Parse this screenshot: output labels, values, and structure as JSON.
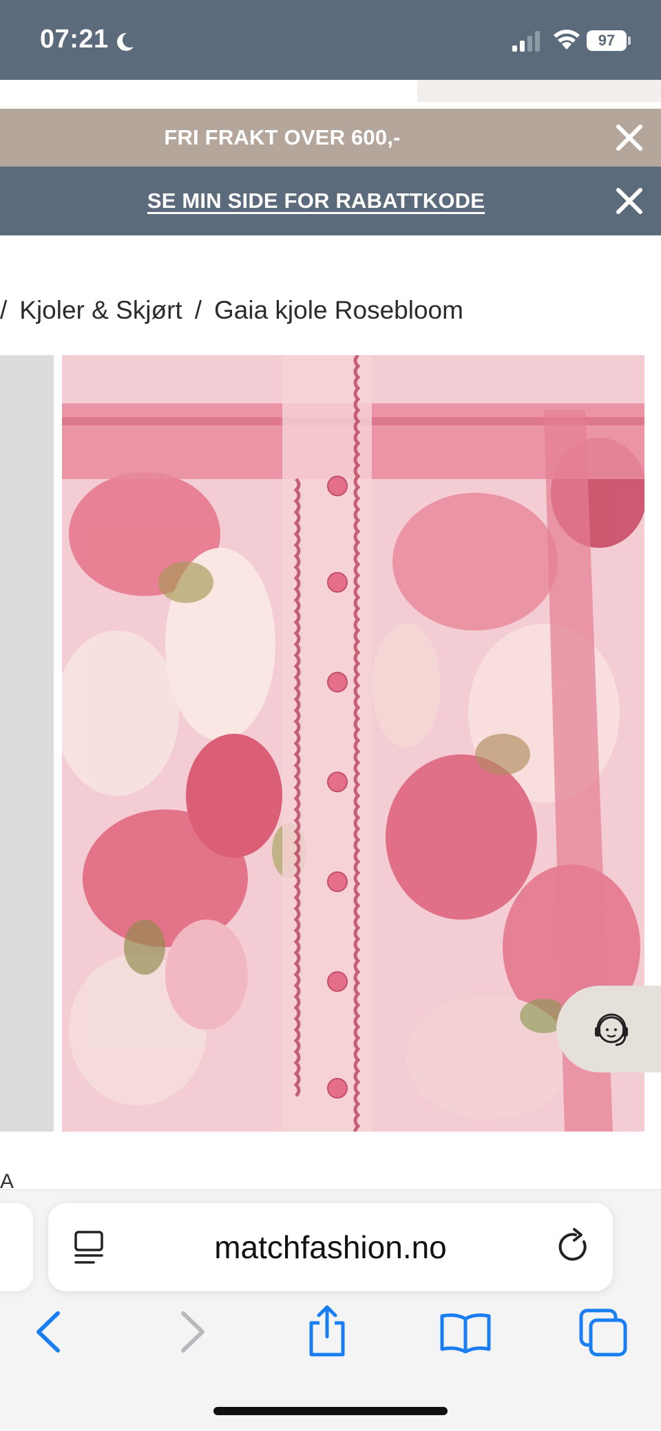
{
  "status_bar": {
    "time": "07:21",
    "battery": "97",
    "icons": [
      "moon-icon",
      "signal-icon",
      "wifi-icon",
      "battery-icon"
    ]
  },
  "banners": {
    "shipping": "FRI FRAKT OVER 600,-",
    "discount": "SE MIN SIDE FOR RABATTKODE"
  },
  "breadcrumb": {
    "separator": "/",
    "items": [
      "Kjoler & Skjørt",
      "Gaia kjole Rosebloom"
    ]
  },
  "product": {
    "image_alt": "Gaia kjole Rosebloom"
  },
  "partial_text": "A",
  "browser": {
    "url": "matchfashion.no",
    "nav_icons": [
      "back-icon",
      "forward-icon",
      "share-icon",
      "bookmarks-icon",
      "tabs-icon"
    ]
  },
  "colors": {
    "header_slate": "#5b6b7c",
    "banner_taupe": "#b5a69b",
    "browser_blue": "#1a7ef3"
  }
}
